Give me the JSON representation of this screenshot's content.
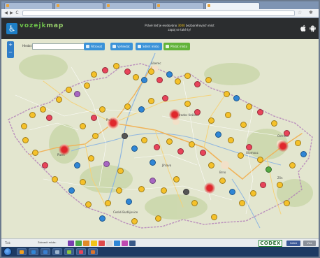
{
  "browser": {
    "tabs": [
      {
        "label": "",
        "active": false
      },
      {
        "label": "",
        "active": false
      },
      {
        "label": "",
        "active": false
      },
      {
        "label": "",
        "active": false
      },
      {
        "label": "",
        "active": true
      }
    ],
    "url": "",
    "nav": {
      "back": "◀",
      "forward": "▶",
      "reload": "C"
    },
    "star": "☆",
    "wrench": "✱"
  },
  "site": {
    "logo_badge": "♿",
    "logo_main": "vozejk",
    "logo_suffix": "map",
    "tagline": "",
    "promo_line1": "Právě teď je evidováno ",
    "promo_count": "3000",
    "promo_line1_end": " bezbariérových míst",
    "promo_line2": "zapoj se také ty!"
  },
  "map": {
    "zoom_plus": "+",
    "zoom_minus": "−",
    "search_label": "Hledat",
    "search_placeholder": "",
    "buttons": [
      {
        "label": "Filtrovat",
        "style": "blue"
      },
      {
        "label": "Vyhledat",
        "style": "blue"
      },
      {
        "label": "Sdílet místo",
        "style": "blue"
      },
      {
        "label": "Přidat místo",
        "style": "green"
      }
    ],
    "cities": [
      {
        "name": "Liberec"
      },
      {
        "name": "Praha"
      },
      {
        "name": "Hradec Králové"
      },
      {
        "name": "Plzeň"
      },
      {
        "name": "Brno"
      },
      {
        "name": "Ostrava"
      },
      {
        "name": "České Budějovice"
      },
      {
        "name": "Jihlava"
      },
      {
        "name": "Olomouc"
      },
      {
        "name": "Zlín"
      }
    ]
  },
  "bottombar": {
    "left_label": "Tisk",
    "filter_label": "Zobrazit místa:",
    "categories": [
      "#7a3fb0",
      "#4aa84a",
      "#e08a2a",
      "#f2c418",
      "#e04a4a",
      "#d8d8d8",
      "#2f86d6",
      "#c04ab0",
      "#3a5a88"
    ],
    "category_text": "",
    "partner": "CODEX",
    "share_label": "Sdílet",
    "more_label": "Více"
  },
  "taskbar": {
    "apps": [
      "#f2a11f",
      "#2f86d6",
      "#3a7fd0",
      "#9fb6cf",
      "#8dc63f",
      "#e8445a",
      "#d9732c"
    ],
    "tray_text": "",
    "clock_time": "",
    "clock_date": ""
  },
  "colors": {
    "header_bg": "#2b2d2f",
    "brand_green": "#6cc04a",
    "accent_yellow": "#f2c418",
    "button_blue": "#3a92d8",
    "button_green": "#62b33a",
    "poi_yellow": "#f5c12a",
    "poi_blue": "#2f86d6",
    "poi_red": "#e8445a",
    "hotspot_red": "#e0272c"
  }
}
